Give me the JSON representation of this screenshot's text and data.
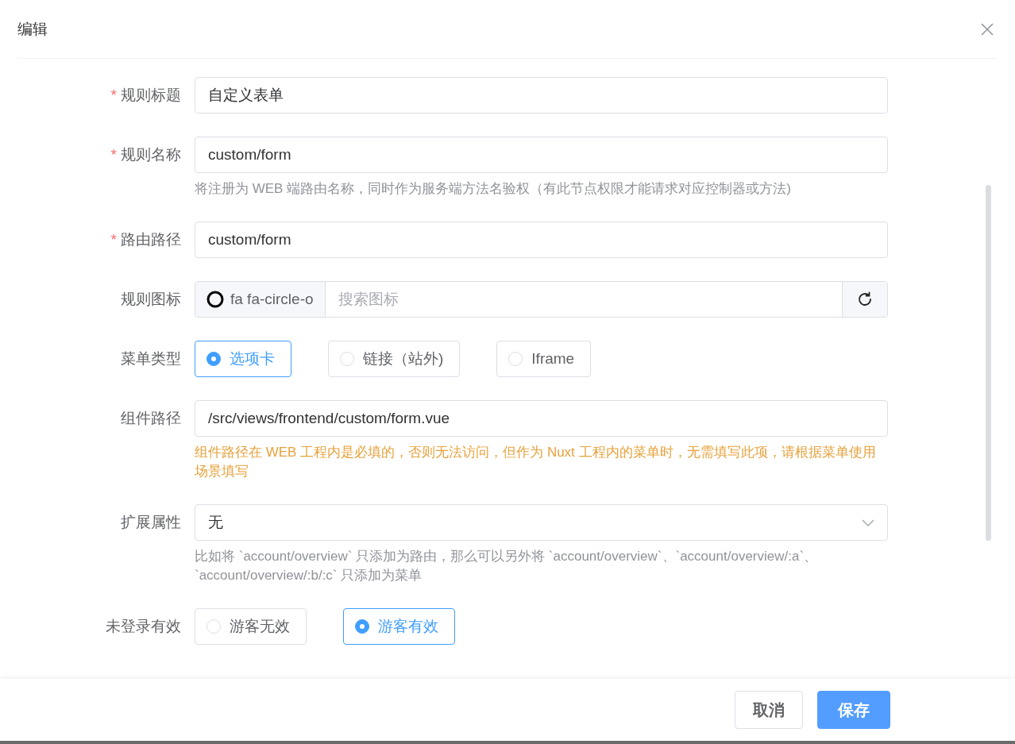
{
  "dialog": {
    "title": "编辑"
  },
  "fields": [
    {
      "kind": "input",
      "label": "规则标题",
      "required_mark": "*",
      "value": "自定义表单"
    },
    {
      "kind": "input",
      "label": "规则名称",
      "required_mark": "*",
      "value": "custom/form",
      "help": {
        "text": "将注册为 WEB 端路由名称，同时作为服务端方法名验权（有此节点权限才能请求对应控制器或方法)",
        "kind": "hint"
      }
    },
    {
      "kind": "input",
      "label": "路由路径",
      "required_mark": "*",
      "value": "custom/form"
    },
    {
      "kind": "icon",
      "label": "规则图标",
      "icon_name": "fa fa-circle-o",
      "placeholder": "搜索图标"
    },
    {
      "kind": "radio",
      "label": "菜单类型",
      "options": [
        {
          "label": "选项卡",
          "selected": true
        },
        {
          "label": "链接（站外)",
          "selected": false
        },
        {
          "label": "Iframe",
          "selected": false
        }
      ]
    },
    {
      "kind": "input",
      "label": "组件路径",
      "value": "/src/views/frontend/custom/form.vue",
      "help": {
        "text": "组件路径在 WEB 工程内是必填的，否则无法访问，但作为 Nuxt 工程内的菜单时，无需填写此项，请根据菜单使用场景填写",
        "kind": "warning"
      }
    },
    {
      "kind": "select",
      "label": "扩展属性",
      "value": "无",
      "help": {
        "text": "比如将 `account/overview` 只添加为路由，那么可以另外将 `account/overview`、`account/overview/:a`、`account/overview/:b/:c` 只添加为菜单",
        "kind": "hint"
      }
    },
    {
      "kind": "radio",
      "label": "未登录有效",
      "options": [
        {
          "label": "游客无效",
          "selected": false
        },
        {
          "label": "游客有效",
          "selected": true
        }
      ]
    }
  ],
  "buttons": [
    {
      "label": "取消",
      "kind": "default"
    },
    {
      "label": "保存",
      "kind": "primary"
    }
  ]
}
